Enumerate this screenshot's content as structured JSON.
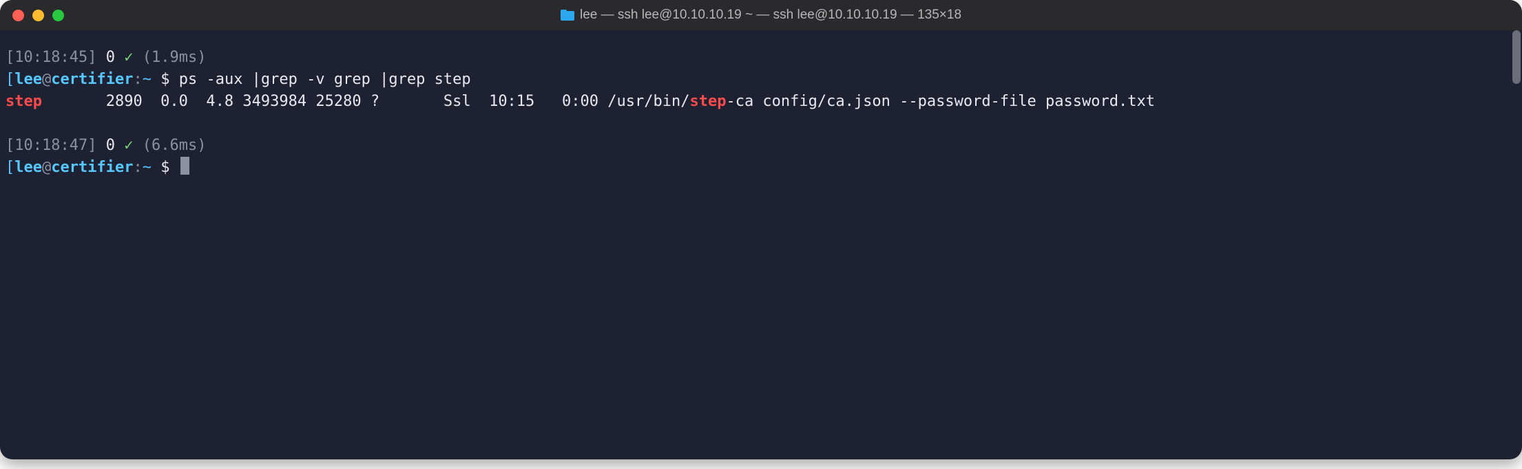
{
  "window": {
    "title": "lee — ssh lee@10.10.10.19 ~ — ssh lee@10.10.10.19 — 135×18"
  },
  "prompt1": {
    "lbracket": "[",
    "time": "10:18:45",
    "rbracket": "]",
    "exitcode": "0",
    "check": "✓",
    "duration": "(1.9ms)",
    "open": "[",
    "user": "lee",
    "at": "@",
    "host": "certifier",
    "colon": ":",
    "cwd": "~",
    "dollar": " $ ",
    "command": "ps -aux |grep -v grep |grep step",
    "close": "]"
  },
  "psrow": {
    "user_hl": "step",
    "pad1": "       ",
    "pid": "2890",
    "cpu": "  0.0",
    "mem": "  4.8",
    "vsz": " 3493984",
    "rss": " 25280",
    "tty": " ?",
    "pad2": "       ",
    "stat": "Ssl",
    "start": "  10:15",
    "time": "   0:00",
    "cmd_pre": " /usr/bin/",
    "cmd_hl": "step",
    "cmd_post": "-ca config/ca.json --password-file password.txt"
  },
  "prompt2": {
    "lbracket": "[",
    "time": "10:18:47",
    "rbracket": "]",
    "exitcode": "0",
    "check": "✓",
    "duration": "(6.6ms)",
    "open": "[",
    "user": "lee",
    "at": "@",
    "host": "certifier",
    "colon": ":",
    "cwd": "~",
    "dollar": " $ ",
    "close": "]"
  }
}
